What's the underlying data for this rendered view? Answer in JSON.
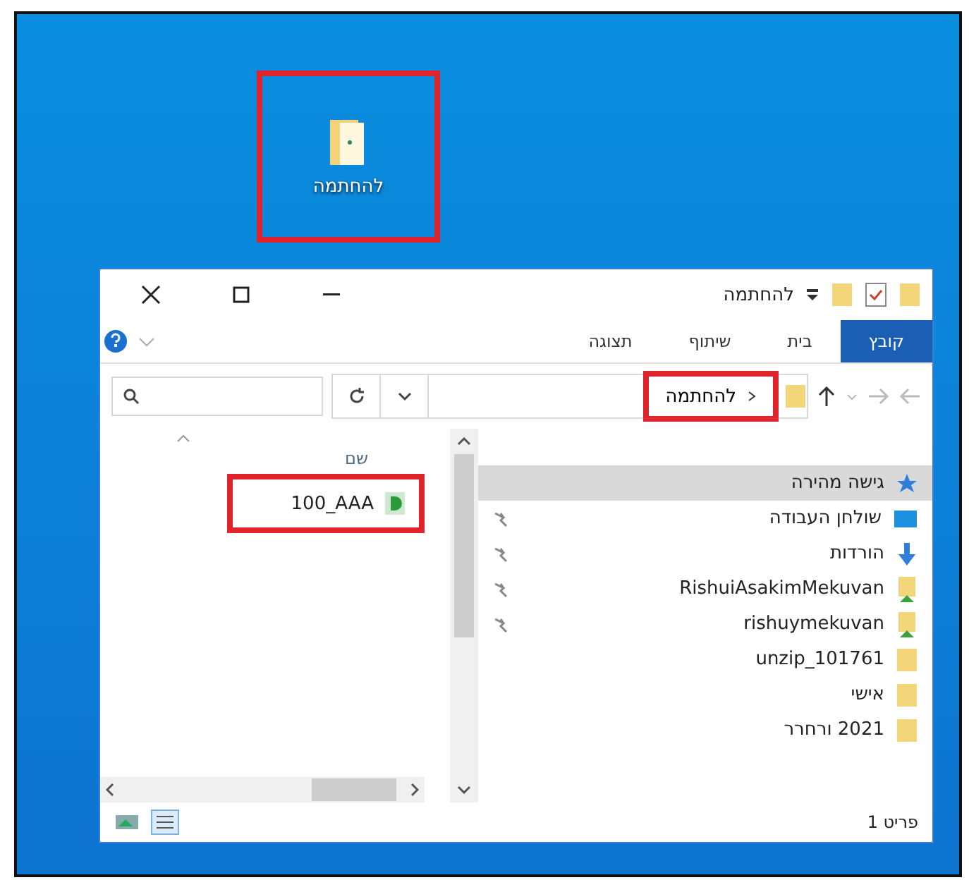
{
  "desktop_icon": {
    "label": "להחתמה",
    "highlighted": true
  },
  "window": {
    "title": "להחתמה",
    "ribbon_tabs": [
      {
        "label": "קובץ",
        "selected": true
      },
      {
        "label": "בית",
        "selected": false
      },
      {
        "label": "שיתוף",
        "selected": false
      },
      {
        "label": "תצוגה",
        "selected": false
      }
    ],
    "address": {
      "crumb": "להחתמה",
      "highlighted": true
    },
    "nav_items": [
      {
        "label": "גישה מהירה",
        "kind": "star",
        "pinned": false,
        "selected": true
      },
      {
        "label": "שולחן העבודה",
        "kind": "desktop",
        "pinned": true,
        "selected": false
      },
      {
        "label": "הורדות",
        "kind": "download",
        "pinned": true,
        "selected": false
      },
      {
        "label": "RishuiAsakimMekuvan",
        "kind": "shared",
        "pinned": true,
        "selected": false
      },
      {
        "label": "rishuymekuvan",
        "kind": "shared",
        "pinned": true,
        "selected": false
      },
      {
        "label": "unzip_101761",
        "kind": "folder",
        "pinned": false,
        "selected": false
      },
      {
        "label": "אישי",
        "kind": "folder",
        "pinned": false,
        "selected": false
      },
      {
        "label": "2021 ורחרר",
        "kind": "folder",
        "pinned": false,
        "selected": false
      }
    ],
    "column_header": "שם",
    "files": [
      {
        "name": "100_AAA",
        "highlighted": true
      }
    ],
    "status": "פריט 1"
  }
}
